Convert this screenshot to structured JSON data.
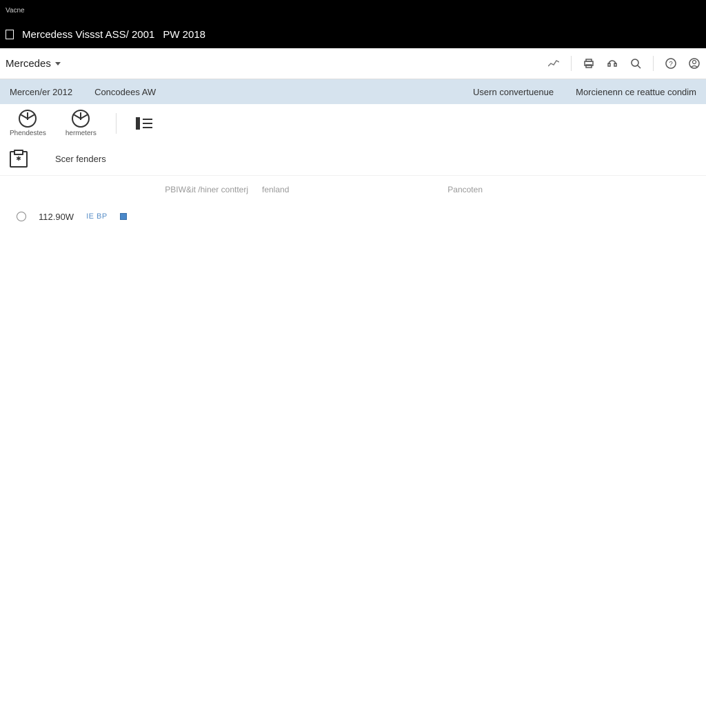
{
  "topbar": {
    "label": "Vacne"
  },
  "titlebar": {
    "part1": "Mercedess Vissst ASS/ 2001",
    "part2": "PW 2018"
  },
  "navbar": {
    "brand": "Mercedes"
  },
  "subnav": {
    "left": [
      {
        "label": "Mercen/er 2012"
      },
      {
        "label": "Concodees AW"
      }
    ],
    "right": [
      {
        "label": "Usern convertuenue"
      },
      {
        "label": "Morcienenn ce reattue condim"
      }
    ]
  },
  "tiles": [
    {
      "label": "Phendestes"
    },
    {
      "label": "hermeters"
    }
  ],
  "section": {
    "title": "Scer fenders"
  },
  "columns": {
    "col1": "PBIW&it /hiner contterj",
    "col2": "fenland",
    "col3": "Pancoten"
  },
  "row": {
    "value": "112.90W",
    "badge": "IE BP"
  }
}
